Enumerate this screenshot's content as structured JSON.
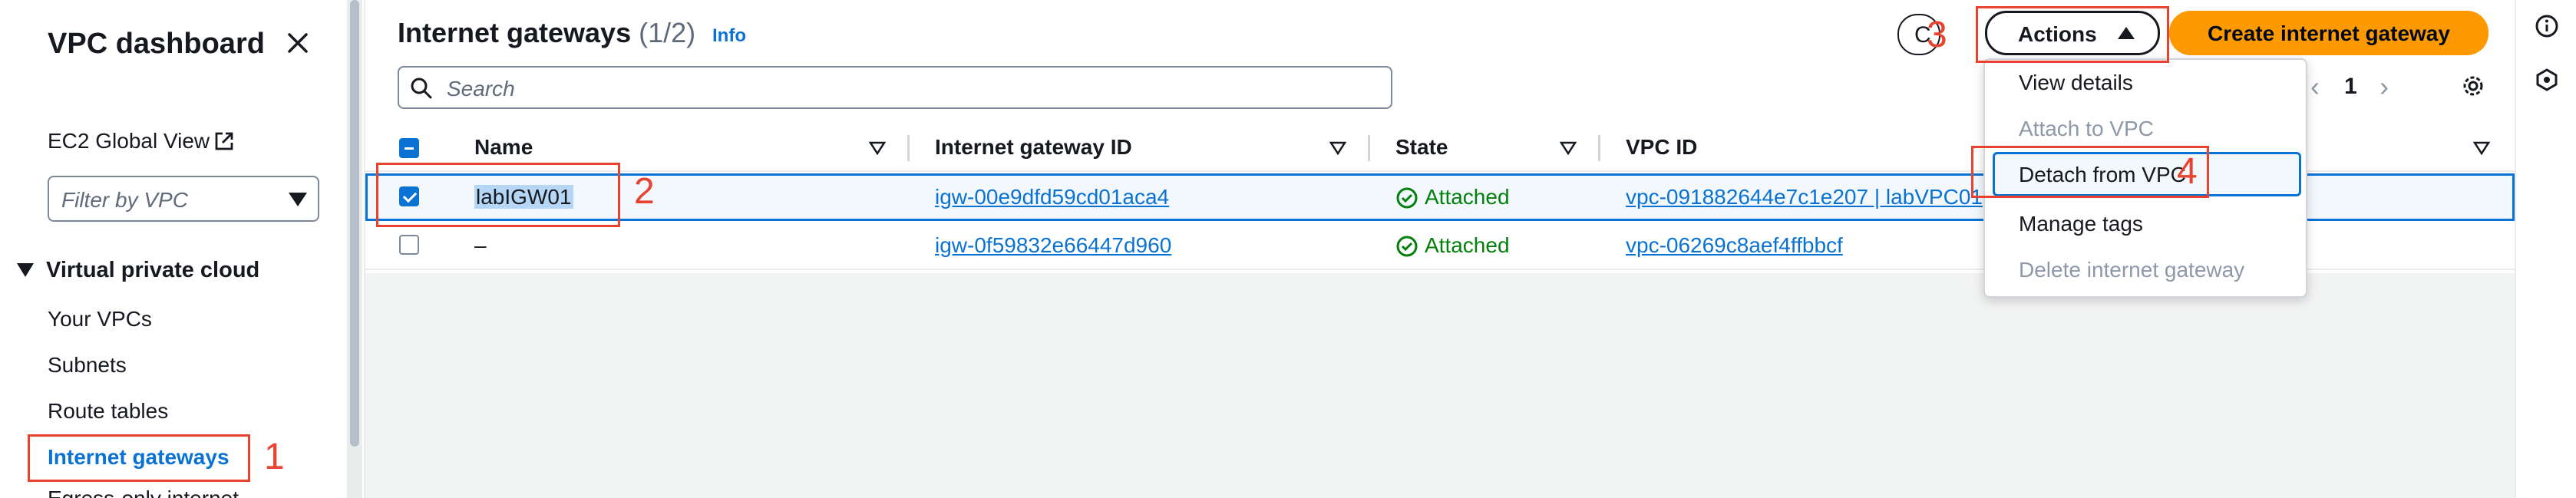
{
  "sidebar": {
    "title": "VPC dashboard",
    "global_view": "EC2 Global View",
    "filter_placeholder": "Filter by VPC",
    "section": "Virtual private cloud",
    "items": [
      {
        "label": "Your VPCs"
      },
      {
        "label": "Subnets"
      },
      {
        "label": "Route tables"
      },
      {
        "label": "Internet gateways",
        "active": true
      }
    ],
    "partial_item": "Egress-only internet"
  },
  "header": {
    "title": "Internet gateways",
    "count": "(1/2)",
    "info": "Info",
    "search_placeholder": "Search",
    "actions_label": "Actions",
    "create_label": "Create internet gateway",
    "page": "1"
  },
  "table": {
    "columns": [
      "Name",
      "Internet gateway ID",
      "State",
      "VPC ID"
    ],
    "rows": [
      {
        "name": "labIGW01",
        "id": "igw-00e9dfd59cd01aca4",
        "state": "Attached",
        "vpc": "vpc-091882644e7c1e207 | labVPC01",
        "selected": true
      },
      {
        "name": "–",
        "id": "igw-0f59832e66447d960",
        "state": "Attached",
        "vpc": "vpc-06269c8aef4ffbbcf",
        "selected": false
      }
    ]
  },
  "actions_menu": {
    "items": [
      {
        "label": "View details",
        "disabled": false
      },
      {
        "label": "Attach to VPC",
        "disabled": true
      },
      {
        "label": "Detach from VPC",
        "disabled": false,
        "highlighted": true
      },
      {
        "label": "Manage tags",
        "disabled": false
      },
      {
        "label": "Delete internet gateway",
        "disabled": true
      }
    ]
  },
  "annotations": [
    "1",
    "2",
    "3",
    "4"
  ],
  "colors": {
    "accent": "#0972d3",
    "primary_button": "#ff9900",
    "success": "#037f0c",
    "annotation": "#e8432f"
  }
}
